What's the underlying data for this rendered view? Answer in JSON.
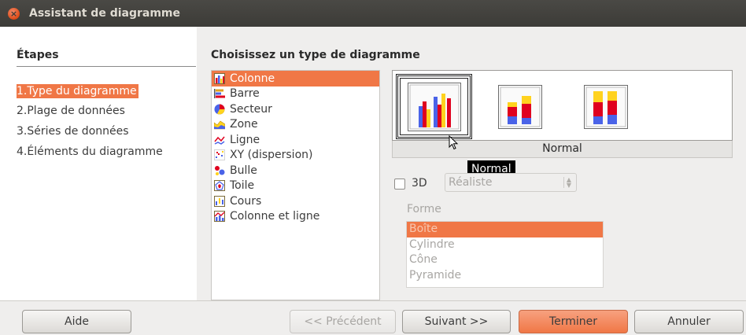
{
  "window": {
    "title": "Assistant de diagramme"
  },
  "steps": {
    "title": "Étapes",
    "items": [
      {
        "label": "1.Type du diagramme",
        "active": true
      },
      {
        "label": "2.Plage de données",
        "active": false
      },
      {
        "label": "3.Séries de données",
        "active": false
      },
      {
        "label": "4.Éléments du diagramme",
        "active": false
      }
    ]
  },
  "main": {
    "title": "Choisissez un type de diagramme",
    "chart_types": [
      {
        "label": "Colonne",
        "icon": "column-chart-icon",
        "selected": true
      },
      {
        "label": "Barre",
        "icon": "bar-chart-icon"
      },
      {
        "label": "Secteur",
        "icon": "pie-chart-icon"
      },
      {
        "label": "Zone",
        "icon": "area-chart-icon"
      },
      {
        "label": "Ligne",
        "icon": "line-chart-icon"
      },
      {
        "label": "XY (dispersion)",
        "icon": "scatter-chart-icon"
      },
      {
        "label": "Bulle",
        "icon": "bubble-chart-icon"
      },
      {
        "label": "Toile",
        "icon": "net-chart-icon"
      },
      {
        "label": "Cours",
        "icon": "stock-chart-icon"
      },
      {
        "label": "Colonne et ligne",
        "icon": "column-line-chart-icon"
      }
    ],
    "variants": [
      {
        "name": "normal-column-icon",
        "selected": true
      },
      {
        "name": "stacked-column-icon",
        "selected": false
      },
      {
        "name": "percent-stacked-column-icon",
        "selected": false
      }
    ],
    "variant_caption": "Normal",
    "tooltip": "Normal",
    "three_d": {
      "label": "3D",
      "checked": false,
      "combo_value": "Réaliste"
    },
    "forme": {
      "label": "Forme",
      "items": [
        {
          "label": "Boîte",
          "selected": true
        },
        {
          "label": "Cylindre"
        },
        {
          "label": "Cône"
        },
        {
          "label": "Pyramide"
        }
      ]
    }
  },
  "buttons": {
    "help": "Aide",
    "previous": "<< Précédent",
    "next": "Suivant >>",
    "finish": "Terminer",
    "cancel": "Annuler"
  },
  "colors": {
    "accent": "#f07746",
    "titlebar": "#3c3b37",
    "close": "#df4a16",
    "bar_blue": "#4a63e8",
    "bar_red": "#e0001e",
    "bar_yellow": "#ffd21e"
  }
}
